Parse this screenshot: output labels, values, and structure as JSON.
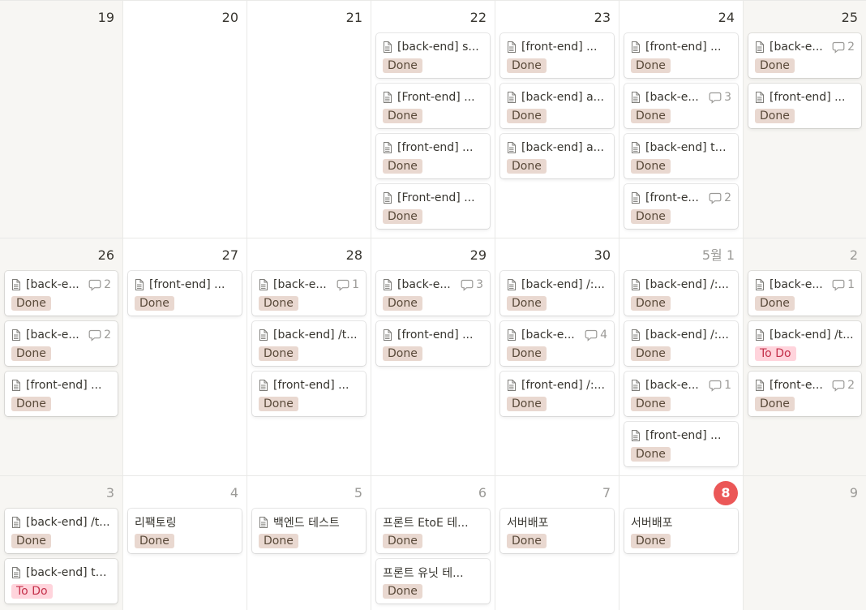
{
  "colors": {
    "done_tag": "#e9d8d0",
    "todo_tag": "#ffd4dc",
    "today": "#eb5757",
    "weekend": "#f7f6f3"
  },
  "weeks": [
    {
      "days": [
        {
          "label": "19",
          "weekend": true,
          "cards": []
        },
        {
          "label": "20",
          "cards": []
        },
        {
          "label": "21",
          "cards": []
        },
        {
          "label": "22",
          "cards": [
            {
              "icon": "document-icon",
              "title": "[back-end] s...",
              "status": "Done"
            },
            {
              "icon": "document-icon",
              "title": "[Front-end] ...",
              "status": "Done"
            },
            {
              "icon": "document-icon",
              "title": "[front-end] ...",
              "status": "Done"
            },
            {
              "icon": "document-icon",
              "title": "[Front-end] ...",
              "status": "Done"
            }
          ]
        },
        {
          "label": "23",
          "cards": [
            {
              "icon": "document-icon",
              "title": "[front-end] ...",
              "status": "Done"
            },
            {
              "icon": "document-icon",
              "title": "[back-end] a...",
              "status": "Done"
            },
            {
              "icon": "document-icon",
              "title": "[back-end] a...",
              "status": "Done"
            }
          ]
        },
        {
          "label": "24",
          "cards": [
            {
              "icon": "document-icon",
              "title": "[front-end] ...",
              "status": "Done"
            },
            {
              "icon": "document-icon",
              "title": "[back-e...",
              "comments": "3",
              "status": "Done"
            },
            {
              "icon": "document-icon",
              "title": "[back-end] te...",
              "status": "Done"
            },
            {
              "icon": "document-icon",
              "title": "[front-e...",
              "comments": "2",
              "status": "Done"
            }
          ]
        },
        {
          "label": "25",
          "weekend": true,
          "cards": [
            {
              "icon": "document-icon",
              "title": "[back-e...",
              "comments": "2",
              "status": "Done"
            },
            {
              "icon": "document-icon",
              "title": "[front-end] ...",
              "status": "Done"
            }
          ]
        }
      ]
    },
    {
      "days": [
        {
          "label": "26",
          "weekend": true,
          "cards": [
            {
              "icon": "document-icon",
              "title": "[back-e...",
              "comments": "2",
              "status": "Done"
            },
            {
              "icon": "document-icon",
              "title": "[back-e...",
              "comments": "2",
              "status": "Done"
            },
            {
              "icon": "document-icon",
              "title": "[front-end] ...",
              "status": "Done"
            }
          ]
        },
        {
          "label": "27",
          "cards": [
            {
              "icon": "document-icon",
              "title": "[front-end] ...",
              "status": "Done"
            }
          ]
        },
        {
          "label": "28",
          "cards": [
            {
              "icon": "document-icon",
              "title": "[back-e...",
              "comments": "1",
              "status": "Done"
            },
            {
              "icon": "document-icon",
              "title": "[back-end] /t...",
              "status": "Done"
            },
            {
              "icon": "document-icon",
              "title": "[front-end] ...",
              "status": "Done"
            }
          ]
        },
        {
          "label": "29",
          "cards": [
            {
              "icon": "document-icon",
              "title": "[back-e...",
              "comments": "3",
              "status": "Done"
            },
            {
              "icon": "document-icon",
              "title": "[front-end] ...",
              "status": "Done"
            }
          ]
        },
        {
          "label": "30",
          "cards": [
            {
              "icon": "document-icon",
              "title": "[back-end] /:...",
              "status": "Done"
            },
            {
              "icon": "document-icon",
              "title": "[back-e...",
              "comments": "4",
              "status": "Done"
            },
            {
              "icon": "document-icon",
              "title": "[front-end] /:...",
              "status": "Done"
            }
          ]
        },
        {
          "label": "5월 1",
          "muted": true,
          "cards": [
            {
              "icon": "document-icon",
              "title": "[back-end] /:...",
              "status": "Done"
            },
            {
              "icon": "document-icon",
              "title": "[back-end] /:...",
              "status": "Done"
            },
            {
              "icon": "document-icon",
              "title": "[back-e...",
              "comments": "1",
              "status": "Done"
            },
            {
              "icon": "document-icon",
              "title": "[front-end] ...",
              "status": "Done"
            }
          ]
        },
        {
          "label": "2",
          "muted": true,
          "weekend": true,
          "cards": [
            {
              "icon": "document-icon",
              "title": "[back-e...",
              "comments": "1",
              "status": "Done"
            },
            {
              "icon": "document-icon",
              "title": "[back-end] /t...",
              "status": "To Do"
            },
            {
              "icon": "document-icon",
              "title": "[front-e...",
              "comments": "2",
              "status": "Done"
            }
          ]
        }
      ]
    },
    {
      "days": [
        {
          "label": "3",
          "muted": true,
          "weekend": true,
          "cards": [
            {
              "icon": "document-icon",
              "title": "[back-end] /t...",
              "status": "Done"
            },
            {
              "icon": "document-icon",
              "title": "[back-end] te...",
              "status": "To Do"
            }
          ]
        },
        {
          "label": "4",
          "muted": true,
          "cards": [
            {
              "title": "리팩토링",
              "status": "Done"
            }
          ]
        },
        {
          "label": "5",
          "muted": true,
          "cards": [
            {
              "icon": "document-icon",
              "title": "백엔드 테스트",
              "status": "Done"
            }
          ]
        },
        {
          "label": "6",
          "muted": true,
          "cards": [
            {
              "title": "프론트 EtoE 테...",
              "status": "Done"
            },
            {
              "title": "프론트 유닛 테...",
              "status": "Done"
            }
          ]
        },
        {
          "label": "7",
          "muted": true,
          "cards": [
            {
              "title": "서버배포",
              "status": "Done"
            }
          ]
        },
        {
          "label": "8",
          "today": true,
          "cards": [
            {
              "title": "서버배포",
              "status": "Done"
            }
          ]
        },
        {
          "label": "9",
          "muted": true,
          "weekend": true,
          "cards": []
        }
      ]
    }
  ]
}
